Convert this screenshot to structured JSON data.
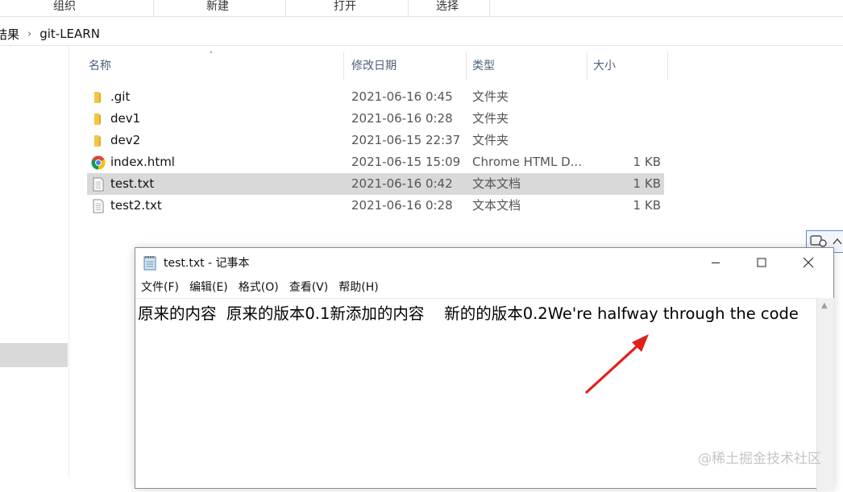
{
  "ribbon": {
    "groups": [
      "组织",
      "新建",
      "打开",
      "选择"
    ]
  },
  "breadcrumb": {
    "prefix": "结果",
    "current": "git-LEARN"
  },
  "file_list": {
    "columns": {
      "name": "名称",
      "modified": "修改日期",
      "type": "类型",
      "size": "大小"
    },
    "rows": [
      {
        "name": ".git",
        "modified": "2021-06-16 0:45",
        "type": "文件夹",
        "size": "",
        "icon": "folder-icon"
      },
      {
        "name": "dev1",
        "modified": "2021-06-16 0:28",
        "type": "文件夹",
        "size": "",
        "icon": "folder-icon"
      },
      {
        "name": "dev2",
        "modified": "2021-06-15 22:37",
        "type": "文件夹",
        "size": "",
        "icon": "folder-icon"
      },
      {
        "name": "index.html",
        "modified": "2021-06-15 15:09",
        "type": "Chrome HTML D...",
        "size": "1 KB",
        "icon": "chrome-icon"
      },
      {
        "name": "test.txt",
        "modified": "2021-06-16 0:42",
        "type": "文本文档",
        "size": "1 KB",
        "icon": "text-file-icon",
        "selected": true
      },
      {
        "name": "test2.txt",
        "modified": "2021-06-16 0:28",
        "type": "文本文档",
        "size": "1 KB",
        "icon": "text-file-icon"
      }
    ]
  },
  "notepad": {
    "title": "test.txt - 记事本",
    "menu": [
      "文件(F)",
      "编辑(E)",
      "格式(O)",
      "查看(V)",
      "帮助(H)"
    ],
    "content": "原来的内容  原来的版本0.1新添加的内容    新的的版本0.2We're halfway through the code"
  },
  "watermark": "@稀土掘金技术社区",
  "colors": {
    "selection": "#d9d9d9",
    "arrow": "#e0201b",
    "header_text": "#4c607a",
    "folder": "#f5c446"
  }
}
